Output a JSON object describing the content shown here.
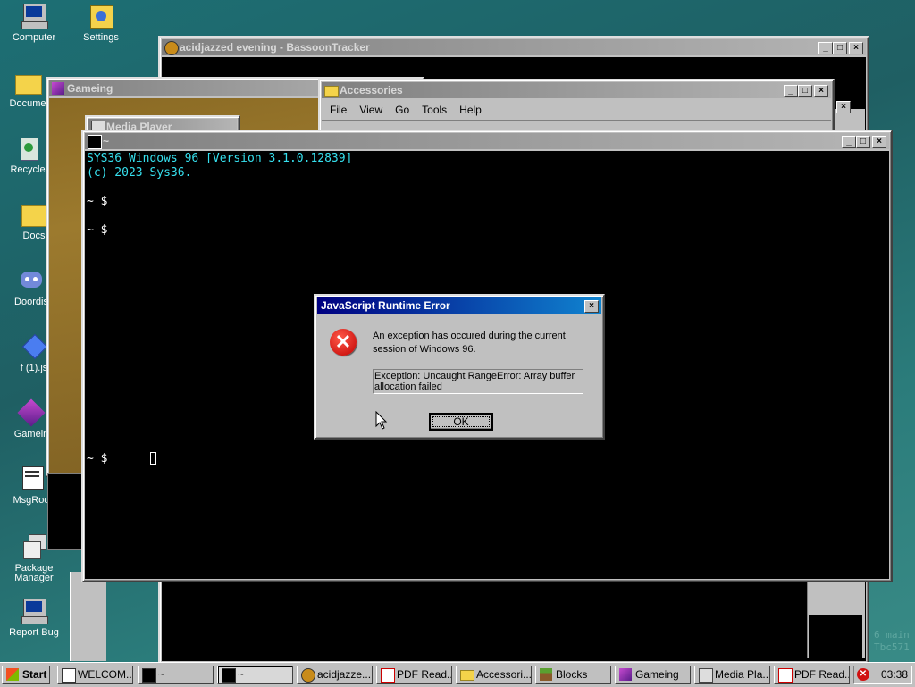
{
  "desktop": {
    "icons": [
      {
        "label": "Computer",
        "icon": "computer-icon"
      },
      {
        "label": "Settings",
        "icon": "settings-icon"
      },
      {
        "label": "Docume",
        "icon": "folder-icon"
      },
      {
        "label": "Recycle",
        "icon": "recycle-bin-icon"
      },
      {
        "label": "Docs",
        "icon": "folder-icon"
      },
      {
        "label": "Doordis",
        "icon": "discord-icon"
      },
      {
        "label": "f (1).js",
        "icon": "diamond-icon"
      },
      {
        "label": "Gamein",
        "icon": "cube-icon"
      },
      {
        "label": "MsgRoo",
        "icon": "msgroom-icon"
      },
      {
        "label": "Package Manager",
        "icon": "package-icon"
      },
      {
        "label": "Report Bug",
        "icon": "report-bug-icon"
      }
    ],
    "bg_text": [
      "6 main",
      "Tbc571"
    ]
  },
  "windows": {
    "bassoon": {
      "title": "acidjazzed evening - BassoonTracker"
    },
    "gameing": {
      "title": "Gameing"
    },
    "accessories": {
      "title": "Accessories",
      "menu": [
        "File",
        "View",
        "Go",
        "Tools",
        "Help"
      ]
    },
    "media": {
      "title": "Media Player"
    },
    "terminal": {
      "title": "~",
      "lines": [
        "SYS36 Windows 96 [Version 3.1.0.12839]",
        "(c) 2023 Sys36.",
        "~ $",
        "~ $",
        "~ $"
      ]
    }
  },
  "dialog": {
    "title": "JavaScript Runtime Error",
    "message": "An exception has occured during the current session of Windows 96.",
    "exception": "Exception: Uncaught RangeError: Array buffer allocation failed",
    "ok_label": "OK"
  },
  "taskbar": {
    "start_label": "Start",
    "items": [
      "WELCOM...",
      "~",
      "~",
      "acidjazze...",
      "PDF Read...",
      "Accessori...",
      "Blocks",
      "Gameing",
      "Media Pla...",
      "PDF Read..."
    ],
    "clock": "03:38"
  },
  "colors": {
    "terminal_text": "#36e0ee",
    "title_active": "#000080",
    "error_red": "#e01010"
  }
}
